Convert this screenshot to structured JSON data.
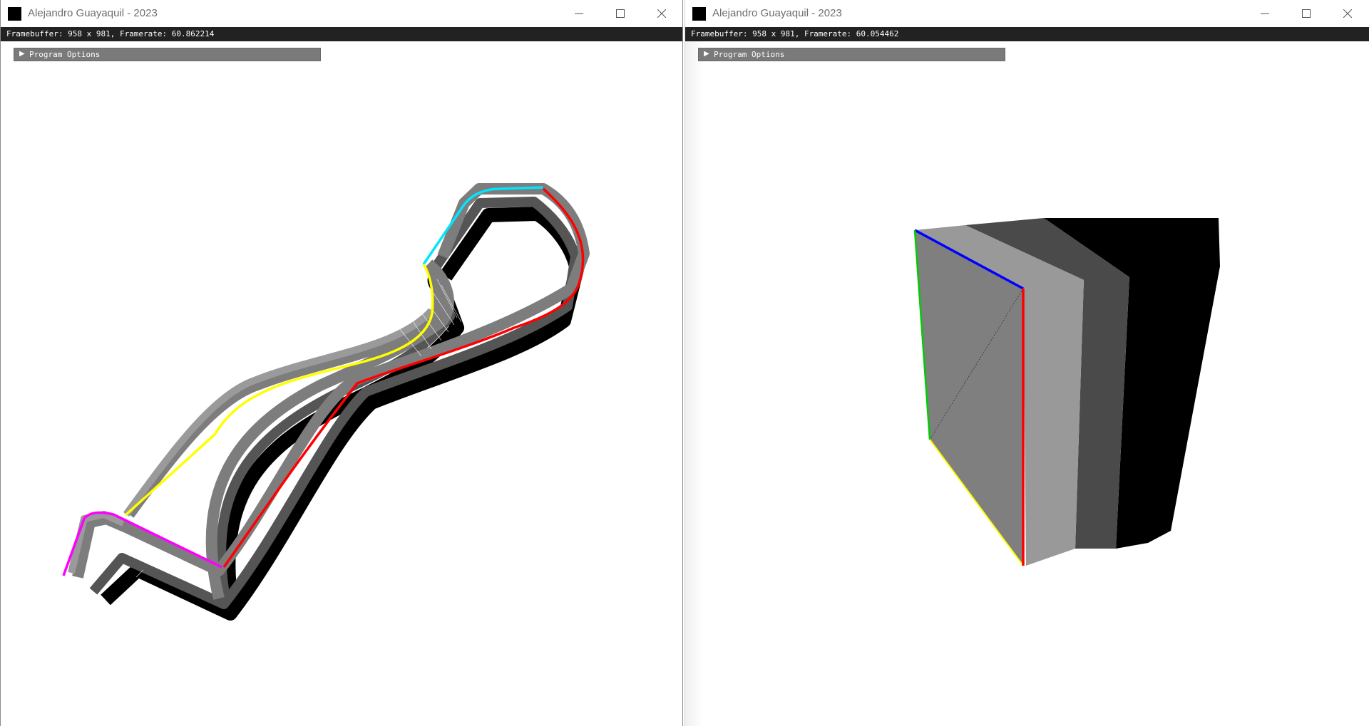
{
  "windows": [
    {
      "title": "Alejandro Guayaquil - 2023",
      "status": "Framebuffer: 958 x 981, Framerate: 60.862214",
      "options_label": "Program Options",
      "controls": {
        "minimize": "minimize-icon",
        "maximize": "maximize-icon",
        "close": "close-icon"
      },
      "scene": "ribbon-curve-sweep"
    },
    {
      "title": "Alejandro Guayaquil - 2023",
      "status": "Framebuffer: 958 x 981, Framerate: 60.054462",
      "options_label": "Program Options",
      "controls": {
        "minimize": "minimize-icon",
        "maximize": "maximize-icon",
        "close": "close-icon"
      },
      "scene": "box-sweep"
    }
  ],
  "colors": {
    "titlebar_bg": "#ffffff",
    "status_bg": "#222222",
    "options_bg": "#7a7a7a",
    "edge_red": "#ff0000",
    "edge_yellow": "#ffff00",
    "edge_cyan": "#00e5ff",
    "edge_magenta": "#ff00ff",
    "edge_blue": "#0000ff",
    "edge_green": "#00cc00"
  }
}
